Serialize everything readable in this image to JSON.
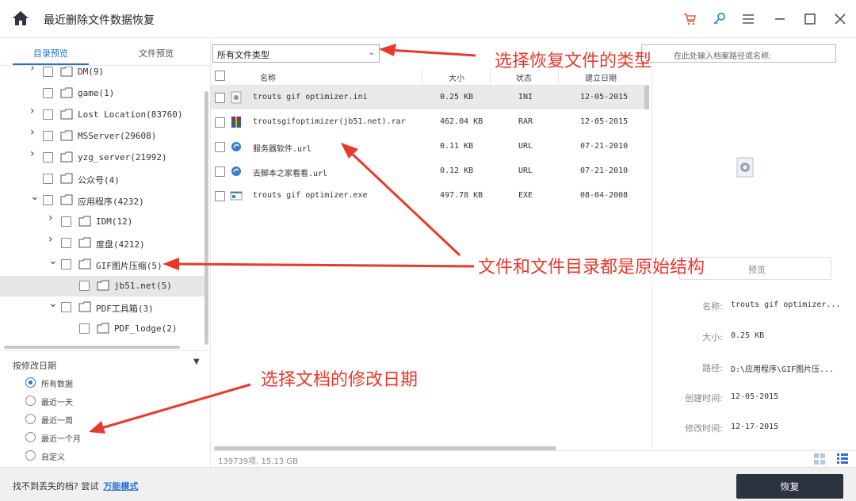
{
  "window": {
    "title": "最近删除文件数据恢复",
    "accent_color": "#2a6fd6",
    "buttons": [
      "cart-icon",
      "key-icon",
      "menu-icon",
      "minimize-icon",
      "maximize-icon",
      "close-icon"
    ]
  },
  "left_tabs": {
    "dir_preview": "目录预览",
    "file_preview": "文件预览"
  },
  "tree": [
    {
      "label": "DM(9)",
      "chevron": ">"
    },
    {
      "label": "game(1)",
      "chevron": ""
    },
    {
      "label": "Lost Location(83760)",
      "chevron": ">"
    },
    {
      "label": "MSServer(29608)",
      "chevron": ">"
    },
    {
      "label": "yzg_server(21992)",
      "chevron": ">"
    },
    {
      "label": "公众号(4)",
      "chevron": ""
    },
    {
      "label": "应用程序(4232)",
      "chevron": "v"
    },
    {
      "label": "IDM(12)",
      "chevron": ">"
    },
    {
      "label": "度盘(4212)",
      "chevron": ">"
    },
    {
      "label": "GIF图片压缩(5)",
      "chevron": "v"
    },
    {
      "label": "jb51.net(5)",
      "chevron": ""
    },
    {
      "label": "PDF工具箱(3)",
      "chevron": "v"
    },
    {
      "label": "PDF_lodge(2)",
      "chevron": ""
    }
  ],
  "date_filter": {
    "title": "按修改日期",
    "options": [
      "所有数据",
      "最近一天",
      "最近一周",
      "最近一个月",
      "自定义"
    ],
    "selected": "所有数据"
  },
  "toolbar": {
    "type_select": "所有文件类型",
    "search_placeholder": "在此处输入档案路径或名称:"
  },
  "list": {
    "columns": {
      "name": "名称",
      "size": "大小",
      "status": "状态",
      "date": "建立日期"
    },
    "rows": [
      {
        "name": "trouts gif optimizer.ini",
        "size": "0.25 KB",
        "status": "INI",
        "date": "12-05-2015",
        "icon": "ini-file-icon",
        "selected": true
      },
      {
        "name": "troutsgifoptimizer(jb51.net).rar",
        "size": "462.04 KB",
        "status": "RAR",
        "date": "12-05-2015",
        "icon": "rar-file-icon",
        "selected": false
      },
      {
        "name": "服务器软件.url",
        "size": "0.11 KB",
        "status": "URL",
        "date": "07-21-2010",
        "icon": "url-file-icon",
        "selected": false
      },
      {
        "name": "去脚本之家看看.url",
        "size": "0.12 KB",
        "status": "URL",
        "date": "07-21-2010",
        "icon": "url-file-icon",
        "selected": false
      },
      {
        "name": "trouts gif optimizer.exe",
        "size": "497.78 KB",
        "status": "EXE",
        "date": "08-04-2008",
        "icon": "exe-file-icon",
        "selected": false
      }
    ],
    "status_count": "139739项, 15.13 GB"
  },
  "preview": {
    "button": "预览",
    "props": [
      {
        "label": "名称:",
        "value": "trouts gif optimizer..."
      },
      {
        "label": "大小:",
        "value": "0.25 KB"
      },
      {
        "label": "路径:",
        "value": "D:\\应用程序\\GIF图片压..."
      },
      {
        "label": "创建时间:",
        "value": "12-05-2015"
      },
      {
        "label": "修改时间:",
        "value": "12-17-2015"
      }
    ]
  },
  "bottom": {
    "hint": "找不到丢失的档? 尝试",
    "hint_link": "万能模式",
    "recover": "恢复"
  },
  "annotations": {
    "type": "选择恢复文件的类型",
    "structure": "文件和文件目录都是原始结构",
    "date": "选择文档的修改日期",
    "color": "#e8392d"
  }
}
